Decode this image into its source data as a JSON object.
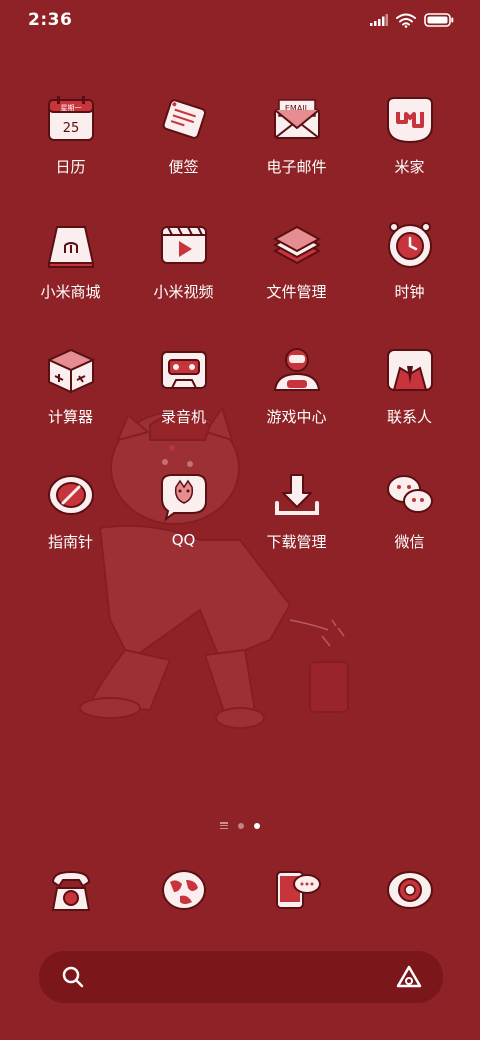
{
  "status": {
    "time": "2:36"
  },
  "apps": [
    {
      "label": "日历",
      "icon": "calendar-icon",
      "cal_week": "星期一",
      "cal_day": "25"
    },
    {
      "label": "便签",
      "icon": "notes-icon"
    },
    {
      "label": "电子邮件",
      "icon": "email-icon",
      "email_text": "EMAIL"
    },
    {
      "label": "米家",
      "icon": "mijia-icon"
    },
    {
      "label": "小米商城",
      "icon": "mi-store-icon"
    },
    {
      "label": "小米视频",
      "icon": "mi-video-icon"
    },
    {
      "label": "文件管理",
      "icon": "file-manager-icon"
    },
    {
      "label": "时钟",
      "icon": "clock-icon"
    },
    {
      "label": "计算器",
      "icon": "calculator-icon"
    },
    {
      "label": "录音机",
      "icon": "recorder-icon"
    },
    {
      "label": "游戏中心",
      "icon": "game-center-icon"
    },
    {
      "label": "联系人",
      "icon": "contacts-icon"
    },
    {
      "label": "指南针",
      "icon": "compass-icon"
    },
    {
      "label": "QQ",
      "icon": "qq-icon"
    },
    {
      "label": "下载管理",
      "icon": "download-icon"
    },
    {
      "label": "微信",
      "icon": "wechat-icon"
    }
  ],
  "dock": [
    {
      "icon": "phone-icon"
    },
    {
      "icon": "browser-icon"
    },
    {
      "icon": "messages-icon"
    },
    {
      "icon": "camera-icon"
    }
  ],
  "page_indicator": {
    "pages": 2,
    "active": 2
  },
  "colors": {
    "background": "#8f2226",
    "icon_fill": "#fbeeee",
    "icon_accent": "#c8343b"
  }
}
